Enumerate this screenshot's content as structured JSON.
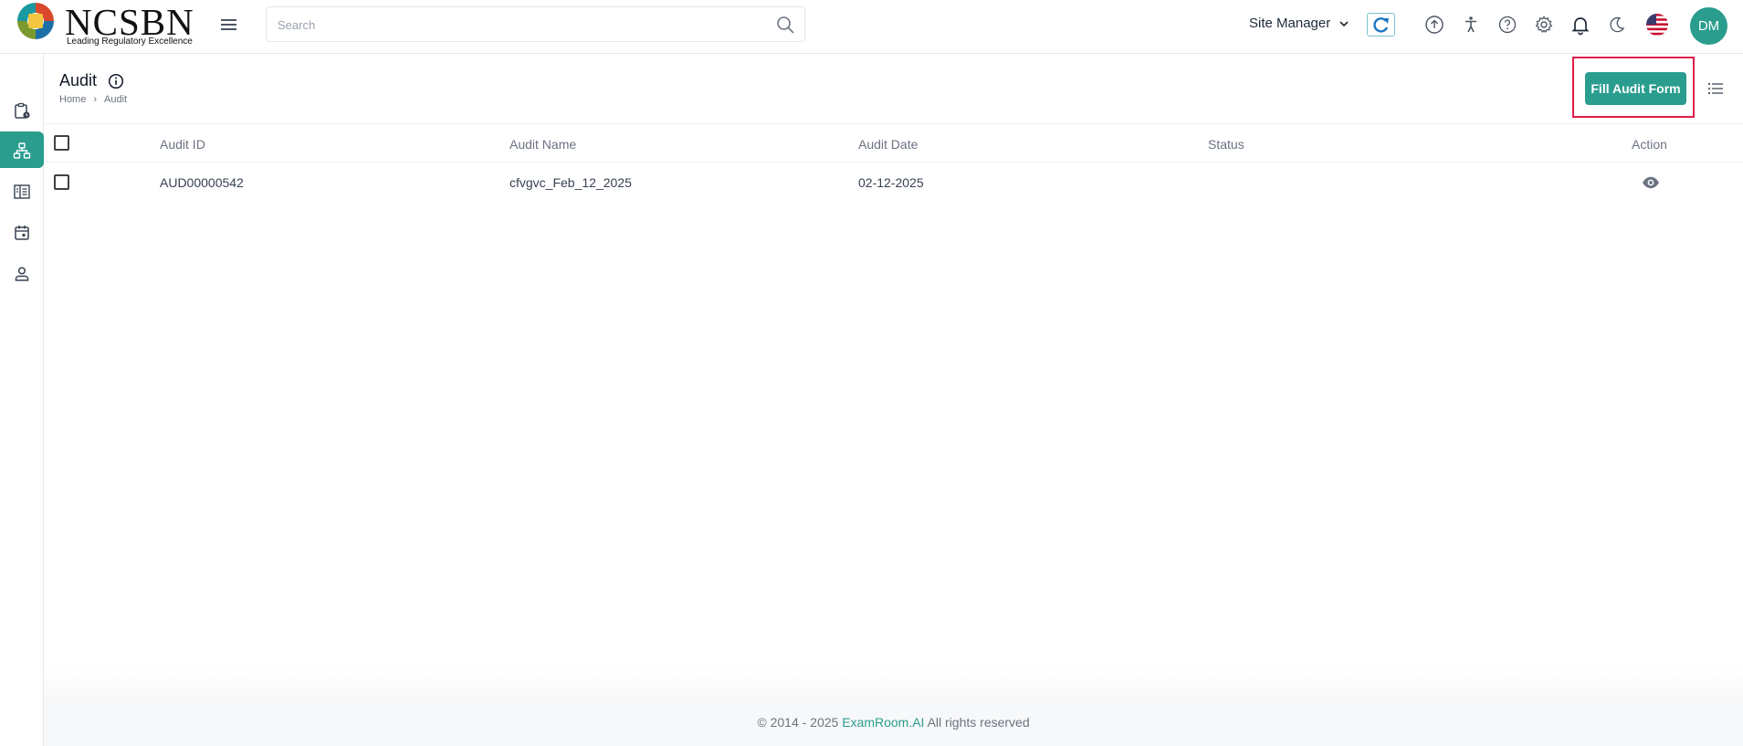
{
  "header": {
    "logo_text": "NCSBN",
    "logo_tagline": "Leading Regulatory Excellence",
    "search_placeholder": "Search",
    "role_label": "Site Manager",
    "avatar_initials": "DM",
    "icons": [
      "menu-icon",
      "search-icon",
      "chevron-down-icon",
      "sync-icon",
      "upload-icon",
      "accessibility-icon",
      "help-icon",
      "settings-icon",
      "bell-icon",
      "moon-icon",
      "us-flag-icon"
    ]
  },
  "sidebar": {
    "items": [
      {
        "icon": "clipboard-clock-icon",
        "active": false
      },
      {
        "icon": "hierarchy-icon",
        "active": true
      },
      {
        "icon": "building-list-icon",
        "active": false
      },
      {
        "icon": "calendar-icon",
        "active": false
      },
      {
        "icon": "person-icon",
        "active": false
      }
    ]
  },
  "page": {
    "title": "Audit",
    "breadcrumb": {
      "home": "Home",
      "separator": "›",
      "current": "Audit"
    },
    "primary_button": "Fill Audit Form"
  },
  "table": {
    "columns": [
      "Audit ID",
      "Audit Name",
      "Audit Date",
      "Status",
      "Action"
    ],
    "rows": [
      {
        "audit_id": "AUD00000542",
        "audit_name": "cfvgvc_Feb_12_2025",
        "audit_date": "02-12-2025",
        "status": "",
        "action_icon": "eye-icon"
      }
    ]
  },
  "footer": {
    "copyright": "© 2014 - 2025",
    "brand": "ExamRoom.AI",
    "rights": "All rights reserved"
  },
  "colors": {
    "accent": "#2a9d8f",
    "highlight": "#e11d48"
  }
}
